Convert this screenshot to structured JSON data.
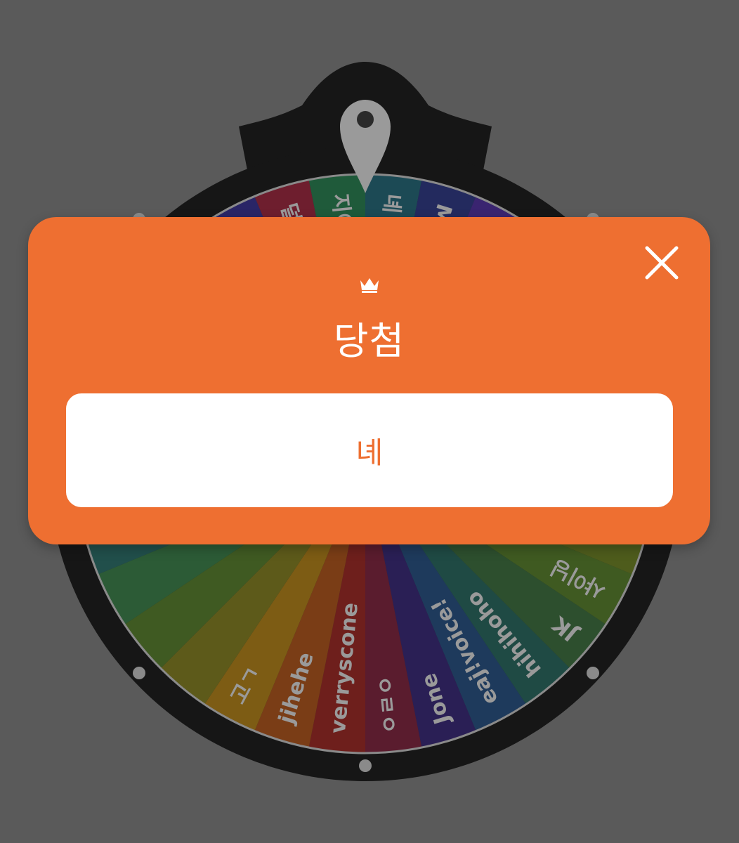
{
  "wheel": {
    "segments": [
      {
        "label": "녜",
        "color": "#1c4a55"
      },
      {
        "label": "MORI",
        "color": "#232a5e"
      },
      {
        "label": "",
        "color": "#3a2470"
      },
      {
        "label": "",
        "color": "#51246c"
      },
      {
        "label": "",
        "color": "#6a2660"
      },
      {
        "label": "",
        "color": "#7c2840"
      },
      {
        "label": "",
        "color": "#7a3a23"
      },
      {
        "label": "",
        "color": "#6f4a1f"
      },
      {
        "label": "",
        "color": "#5f5b1d"
      },
      {
        "label": "",
        "color": "#4e5c1c"
      },
      {
        "label": "샤이닝",
        "color": "#3f5a21"
      },
      {
        "label": "JK",
        "color": "#2d4f2e"
      },
      {
        "label": "hihihoho",
        "color": "#1f4a44"
      },
      {
        "label": "eaj!voice!",
        "color": "#1e3a5c"
      },
      {
        "label": "Jone",
        "color": "#2a1f55"
      },
      {
        "label": "ㅇㄹㅇ",
        "color": "#5a1c2e"
      },
      {
        "label": "verryscone",
        "color": "#6e1f1c"
      },
      {
        "label": "jihehe",
        "color": "#7a3d16"
      },
      {
        "label": "고ㄱ",
        "color": "#7d5c14"
      },
      {
        "label": "",
        "color": "#5d5a1a"
      },
      {
        "label": "",
        "color": "#3f5a22"
      },
      {
        "label": "",
        "color": "#2c5b36"
      },
      {
        "label": "",
        "color": "#214f4b"
      },
      {
        "label": "",
        "color": "#22375f"
      },
      {
        "label": "",
        "color": "#3a2470"
      },
      {
        "label": "",
        "color": "#2f5a3a"
      },
      {
        "label": "",
        "color": "#23367a"
      },
      {
        "label": "",
        "color": "#3a2a6e"
      },
      {
        "label": "",
        "color": "#5e2462"
      },
      {
        "label": "",
        "color": "#2a2566"
      },
      {
        "label": "덜랍",
        "color": "#6e1e2e"
      },
      {
        "label": "지이아",
        "color": "#1f5a3a"
      }
    ]
  },
  "dialog": {
    "title": "당첨",
    "result": "녜",
    "crown_icon": "crown-icon",
    "close_icon": "close-icon",
    "accent_color": "#ee6f31"
  }
}
